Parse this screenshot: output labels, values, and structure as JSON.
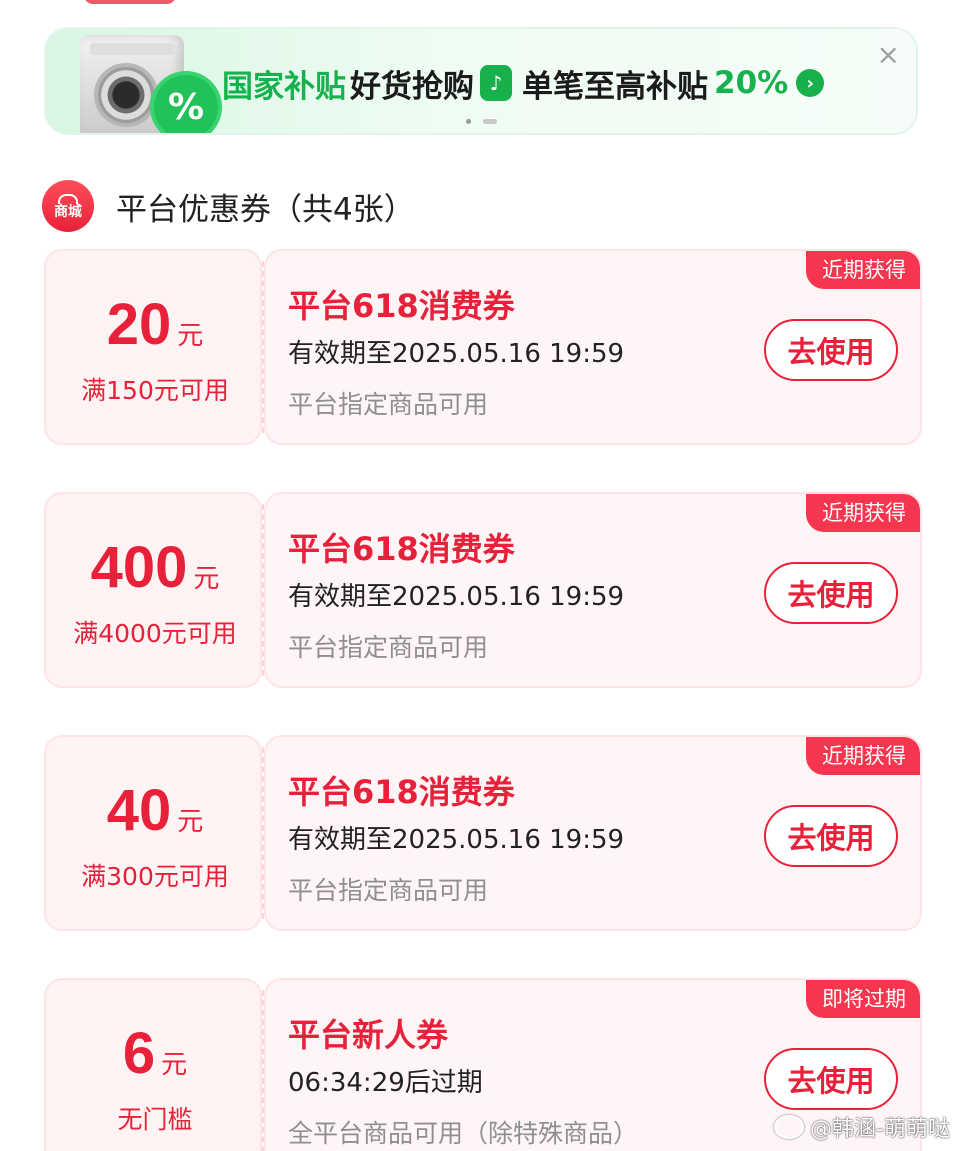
{
  "banner": {
    "part1": "国家补贴",
    "part2": "好货抢购",
    "part3": "单笔至高补贴",
    "part4": "20%",
    "badge_symbol": "%",
    "close_symbol": "×",
    "arrow_symbol": "›",
    "colors": {
      "green": "#16b24e"
    }
  },
  "section": {
    "icon_label": "商城",
    "title": "平台优惠券（共4张）"
  },
  "coupons": [
    {
      "amount": "20",
      "unit": "元",
      "threshold": "满150元可用",
      "title": "平台618消费券",
      "validity": "有效期至2025.05.16 19:59",
      "scope": "平台指定商品可用",
      "tag": "近期获得",
      "button": "去使用"
    },
    {
      "amount": "400",
      "unit": "元",
      "threshold": "满4000元可用",
      "title": "平台618消费券",
      "validity": "有效期至2025.05.16 19:59",
      "scope": "平台指定商品可用",
      "tag": "近期获得",
      "button": "去使用"
    },
    {
      "amount": "40",
      "unit": "元",
      "threshold": "满300元可用",
      "title": "平台618消费券",
      "validity": "有效期至2025.05.16 19:59",
      "scope": "平台指定商品可用",
      "tag": "近期获得",
      "button": "去使用"
    },
    {
      "amount": "6",
      "unit": "元",
      "threshold": "无门槛",
      "title": "平台新人券",
      "validity": "06:34:29后过期",
      "scope": "全平台商品可用（除特殊商品）",
      "tag": "即将过期",
      "button": "去使用"
    }
  ],
  "watermark": "@韩涵-萌萌哒",
  "colors": {
    "accent": "#e8213a",
    "tag_bg": "#f6364e",
    "coupon_bg": "#fff5f6"
  }
}
